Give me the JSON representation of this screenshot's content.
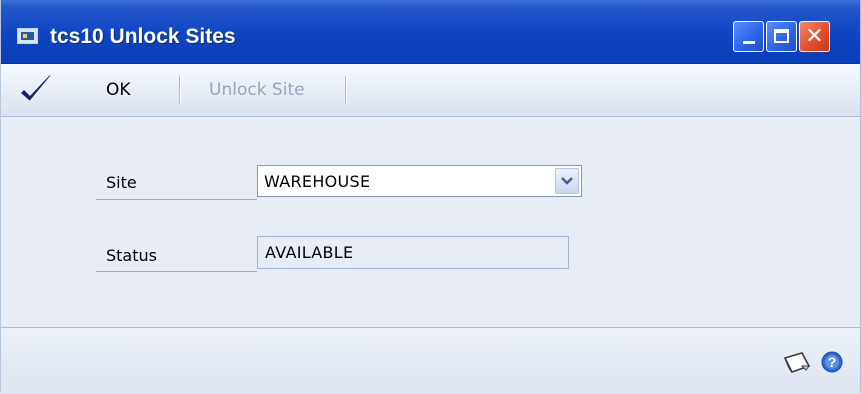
{
  "window": {
    "title": "tcs10 Unlock Sites",
    "icon": "window-app-icon",
    "controls": [
      "minimize",
      "maximize",
      "close"
    ]
  },
  "toolbar": {
    "ok_label": "OK",
    "unlock_label": "Unlock Site",
    "unlock_enabled": false,
    "check_icon": "checkmark-icon"
  },
  "form": {
    "site_label": "Site",
    "site_value": "WAREHOUSE",
    "status_label": "Status",
    "status_value": "AVAILABLE"
  },
  "statusbar": {
    "icons": [
      "note-icon",
      "help-icon"
    ]
  },
  "colors": {
    "titlebar": "#0f45c2",
    "body_bg": "#e8edf5",
    "disabled_text": "#9aa3b0"
  }
}
